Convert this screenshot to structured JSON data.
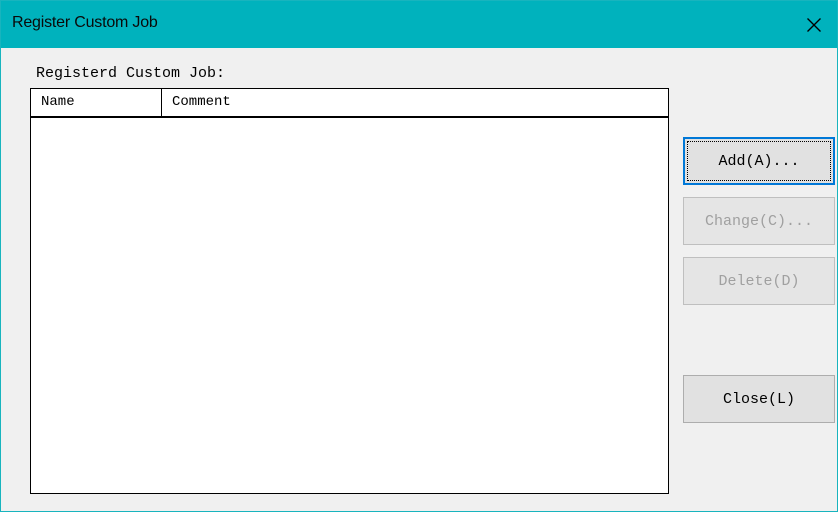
{
  "window": {
    "title": "Register Custom Job",
    "close_glyph": "✕",
    "titlebar_color": "#00b2bd"
  },
  "list": {
    "label": "Registerd Custom Job:",
    "columns": [
      "Name",
      "Comment"
    ],
    "rows": []
  },
  "buttons": {
    "add": "Add(A)...",
    "change": "Change(C)...",
    "delete": "Delete(D)",
    "close": "Close(L)"
  },
  "icons": {
    "close": "close-icon"
  }
}
